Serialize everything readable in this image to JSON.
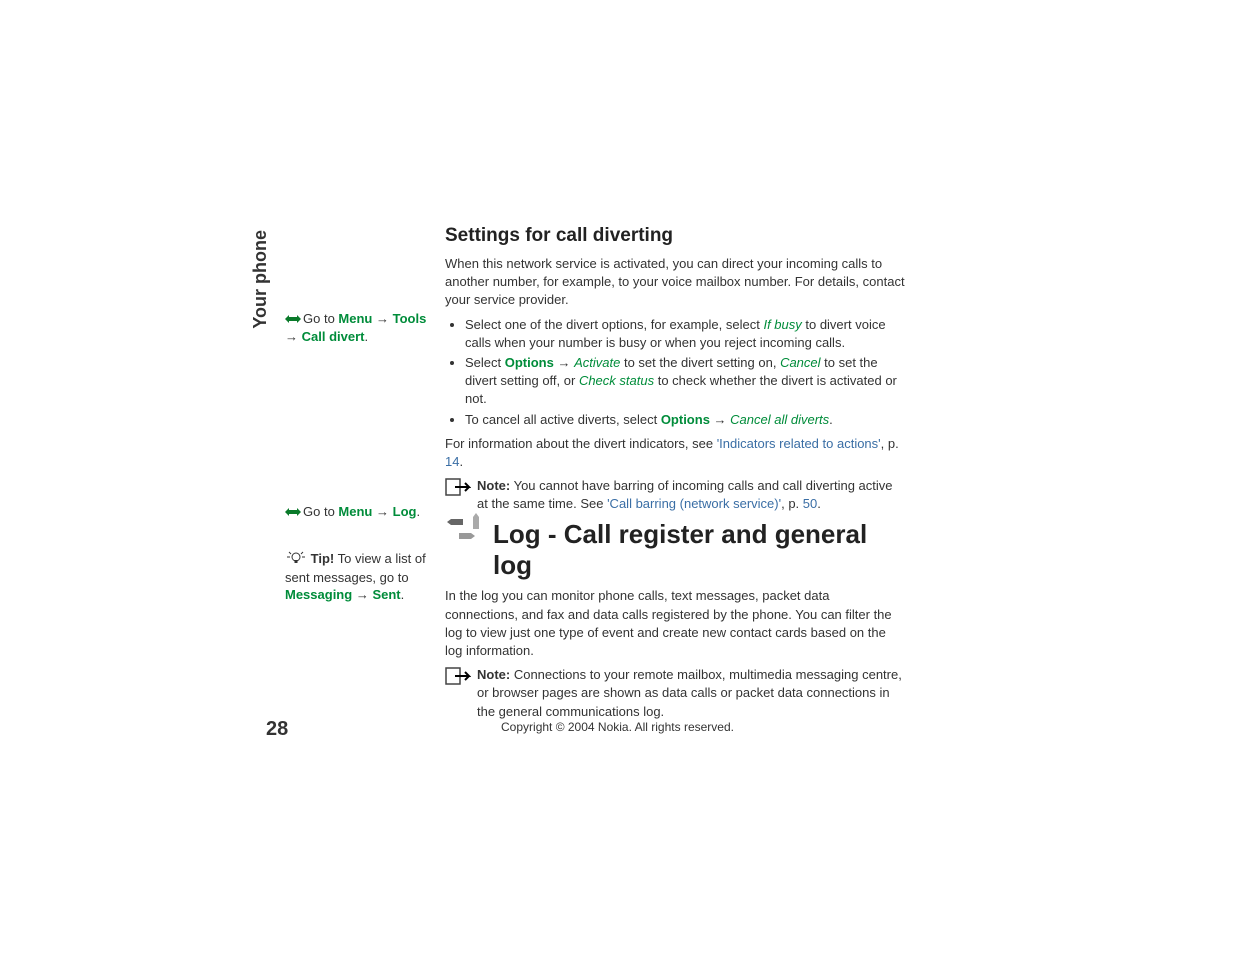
{
  "sidebar_label": "Your phone",
  "nav1": {
    "prefix": "Go to ",
    "menu": "Menu",
    "arrow": "→",
    "tools": "Tools",
    "call_divert": "Call divert",
    "period": "."
  },
  "nav2": {
    "prefix": "Go to ",
    "menu": "Menu",
    "arrow": "→",
    "log": "Log",
    "period": "."
  },
  "nav3": {
    "tip_label": "Tip!",
    "text1": " To view a list of sent messages, go to ",
    "messaging": "Messaging",
    "arrow": "→",
    "sent": "Sent",
    "period": "."
  },
  "h2": "Settings for call diverting",
  "p1": "When this network service is activated, you can direct your incoming calls to another number, for example, to your voice mailbox number. For details, contact your service provider.",
  "bullet1": {
    "t1": "Select one of the divert options, for example, select ",
    "ifbusy": "If busy",
    "t2": " to divert voice calls when your number is busy or when you reject incoming calls."
  },
  "bullet2": {
    "t1": "Select ",
    "options": "Options",
    "arrow": "→",
    "activate": "Activate",
    "t2": " to set the divert setting on, ",
    "cancel": "Cancel",
    "t3": " to set the divert setting off, or ",
    "check": "Check status",
    "t4": " to check whether the divert is activated or not."
  },
  "bullet3": {
    "t1": "To cancel all active diverts, select ",
    "options": "Options",
    "arrow": "→",
    "cancelall": "Cancel all diverts",
    "period": "."
  },
  "p2": {
    "t1": "For information about the divert indicators, see ",
    "link": "'Indicators related to actions'",
    "t2": ", p. ",
    "page": "14",
    "period": "."
  },
  "note1": {
    "label": "Note:",
    "t1": " You cannot have barring of incoming calls and call diverting active at the same time. See ",
    "link": "'Call barring (network service)'",
    "t2": ", p. ",
    "page": "50",
    "period": "."
  },
  "h1_log": "Log - Call register and general log",
  "p3": "In the log you can monitor phone calls, text messages, packet data connections, and fax and data calls registered by the phone. You can filter the log to view just one type of event and create new contact cards based on the log information.",
  "note2": {
    "label": "Note:",
    "t1": " Connections to your remote mailbox, multimedia messaging centre, or browser pages are shown as data calls or packet data connections in the general communications log."
  },
  "footer": "Copyright © 2004 Nokia. All rights reserved.",
  "page_number": "28"
}
